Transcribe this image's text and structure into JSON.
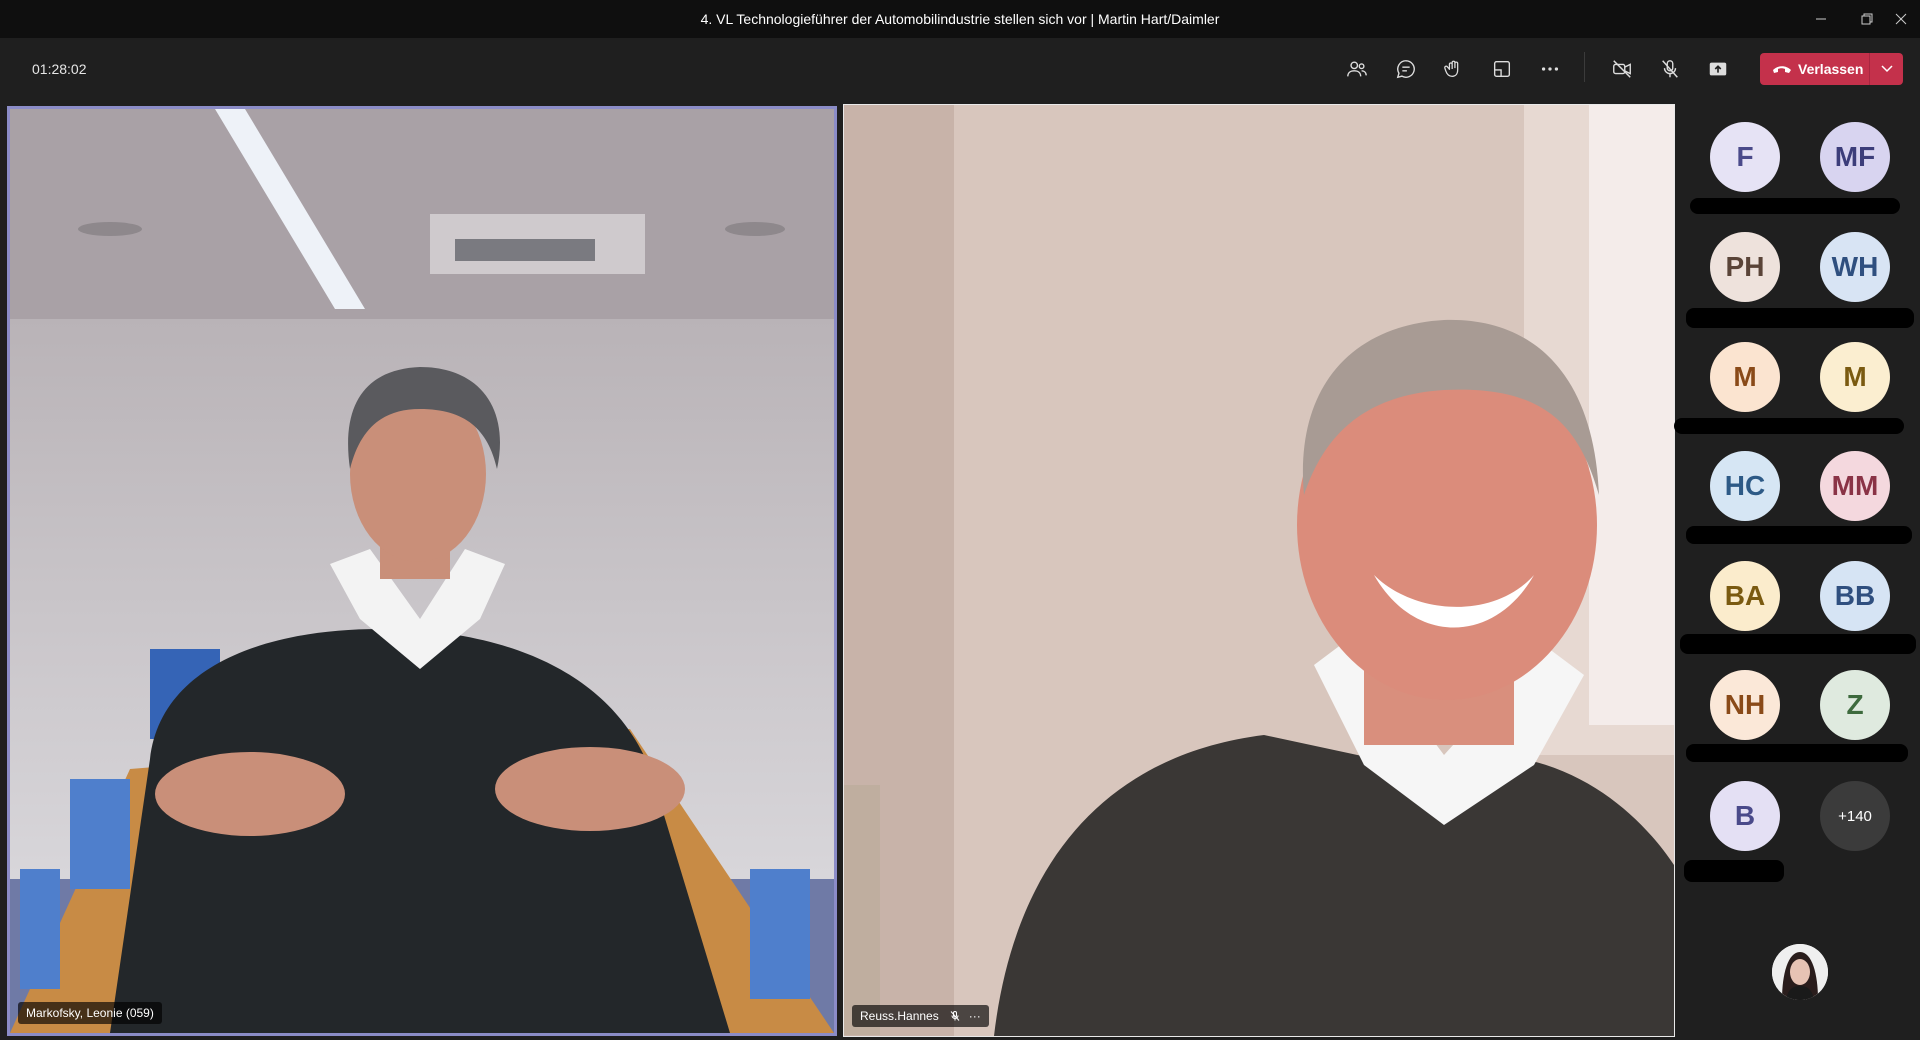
{
  "window": {
    "title": "4. VL Technologieführer der Automobilindustrie stellen sich vor | Martin Hart/Daimler"
  },
  "toolbar": {
    "timer": "01:28:02",
    "leave_label": "Verlassen",
    "icons": [
      "participants-icon",
      "chat-icon",
      "reactions-icon",
      "rooms-icon",
      "more-icon",
      "camera-off-icon",
      "mic-off-icon",
      "share-icon"
    ]
  },
  "tiles": {
    "left_label": "Markofsky, Leonie (059)",
    "right_label": "Reuss.Hannes",
    "right_more": "···"
  },
  "participants": [
    {
      "initials": "F",
      "bg": "#e6e3f5",
      "fg": "#4a4a8a"
    },
    {
      "initials": "MF",
      "bg": "#d8d4f0",
      "fg": "#3c3d7a"
    },
    {
      "initials": "PH",
      "bg": "#eee2dc",
      "fg": "#5a4438"
    },
    {
      "initials": "WH",
      "bg": "#d8e4f4",
      "fg": "#2f4f7f"
    },
    {
      "initials": "M",
      "bg": "#fbe4d0",
      "fg": "#8a4a18"
    },
    {
      "initials": "M",
      "bg": "#fbeed0",
      "fg": "#7a5a10"
    },
    {
      "initials": "HC",
      "bg": "#d6e6f4",
      "fg": "#2d5a86"
    },
    {
      "initials": "MM",
      "bg": "#f4d8de",
      "fg": "#8a3346"
    },
    {
      "initials": "BA",
      "bg": "#fbeccc",
      "fg": "#7a5a10"
    },
    {
      "initials": "BB",
      "bg": "#d6e4f4",
      "fg": "#2f4f7f"
    },
    {
      "initials": "NH",
      "bg": "#fbe8d8",
      "fg": "#8a4a18"
    },
    {
      "initials": "Z",
      "bg": "#dfeadf",
      "fg": "#3d6a3d"
    },
    {
      "initials": "B",
      "bg": "#e4e0f4",
      "fg": "#4a4a8a"
    },
    {
      "initials": "+140",
      "bg": "#3b3b3b",
      "fg": "#ffffff"
    }
  ]
}
